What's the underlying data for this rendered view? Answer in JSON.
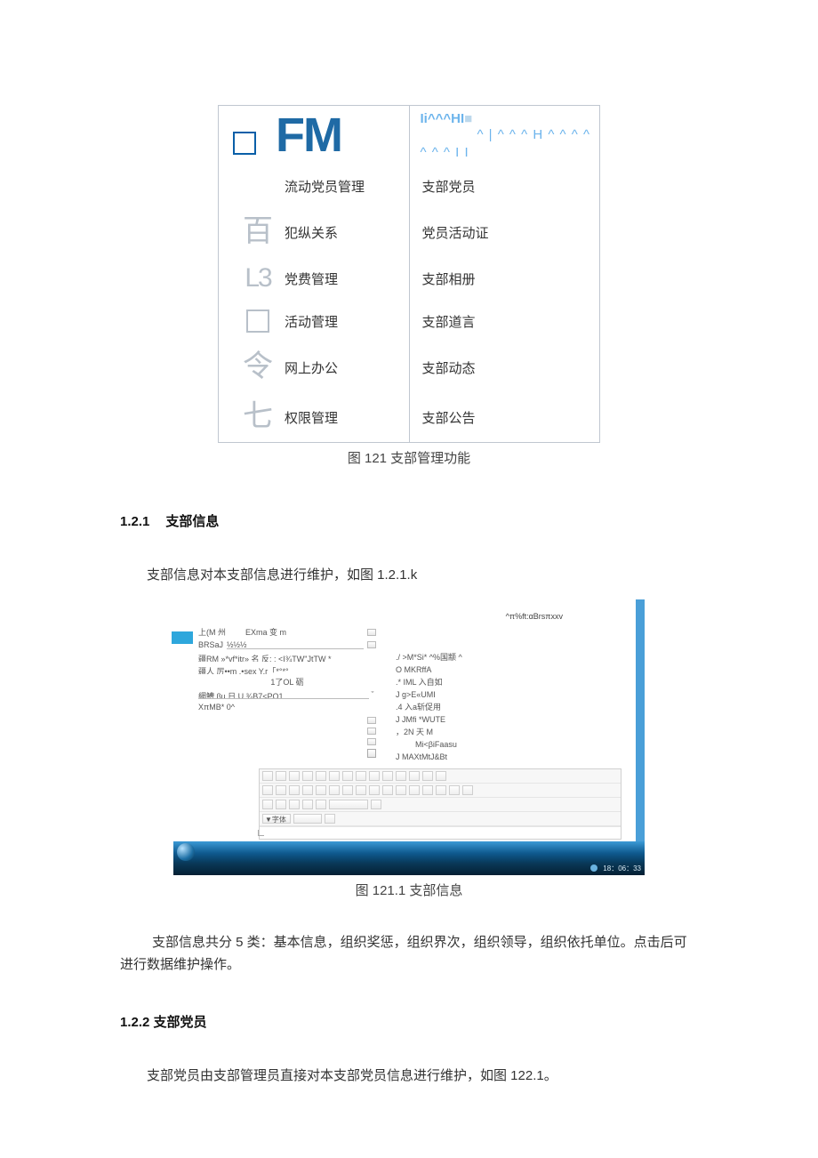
{
  "diagram121": {
    "header": {
      "logo_text": "FM",
      "right_line1": "Ii^^^HI",
      "right_block": "■",
      "right_line2": "^ | ^ ^ ^ H ^ ^ ^ ^",
      "right_line3": "^ ^ ^ I I"
    },
    "left_rows": [
      {
        "icon_type": "none",
        "label": "流动党员管理"
      },
      {
        "icon_type": "char",
        "icon": "百",
        "label": "犯纵关系"
      },
      {
        "icon_type": "l3",
        "icon": "L3",
        "label": "党费管理"
      },
      {
        "icon_type": "box",
        "icon": "",
        "label": "活动菅理"
      },
      {
        "icon_type": "char",
        "icon": "令",
        "label": "网上办公"
      },
      {
        "icon_type": "char",
        "icon": "七",
        "label": "权限管理"
      }
    ],
    "right_rows": [
      "支部党员",
      "党员活动证",
      "支部相册",
      "支部道言",
      "支部动态",
      "支部公告"
    ],
    "caption": "图 121 支部管理功能"
  },
  "section_121": {
    "heading_num": "1.2.1",
    "heading_text": "支部信息",
    "intro": "支部信息对本支部信息进行维护，如图 1.2.1.k"
  },
  "screenshot": {
    "path_text": "^π%ft:αBrsπxxv",
    "left_lines": {
      "l1_label": "上(M 州",
      "l1_val": "EXma 变 m",
      "l2_label": "BRSaJ",
      "l2_val": "½½½",
      "l3": "疆RM »*vf*itr» 名 反: : <I¾TW\"JtTW *",
      "l4": "疆人 厉••m .•sex Y.г「*°*°",
      "l5_center": "1了OL 砺",
      "l6": "網鰽 βu 日 U ¾B7<PO1",
      "l7": "XπMB* 0^"
    },
    "right_lines": [
      "./ >M*Si*  ^%国颛 ^",
      "O MKRffA",
      ".* IML 入自如",
      "J g>E«UMI",
      ".4  入a斩促用",
      "J JMfi *WUTE",
      "，2N 天 M",
      "Mi<βiFaasu",
      "J MAXtMtJ&Bt"
    ],
    "editor_dropdown": "▼字体",
    "clock": "18：06：33",
    "caption": "图 121.1 支部信息"
  },
  "section_121_after": "支部信息共分 5 类：基本信息，组织奖惩，组织界次，组织领导，组织依托单位。点击后可进行数据维护操作。",
  "section_122": {
    "heading": "1.2.2 支部党员",
    "intro": "支部党员由支部管理员直接对本支部党员信息进行维护，如图 122.1。"
  }
}
